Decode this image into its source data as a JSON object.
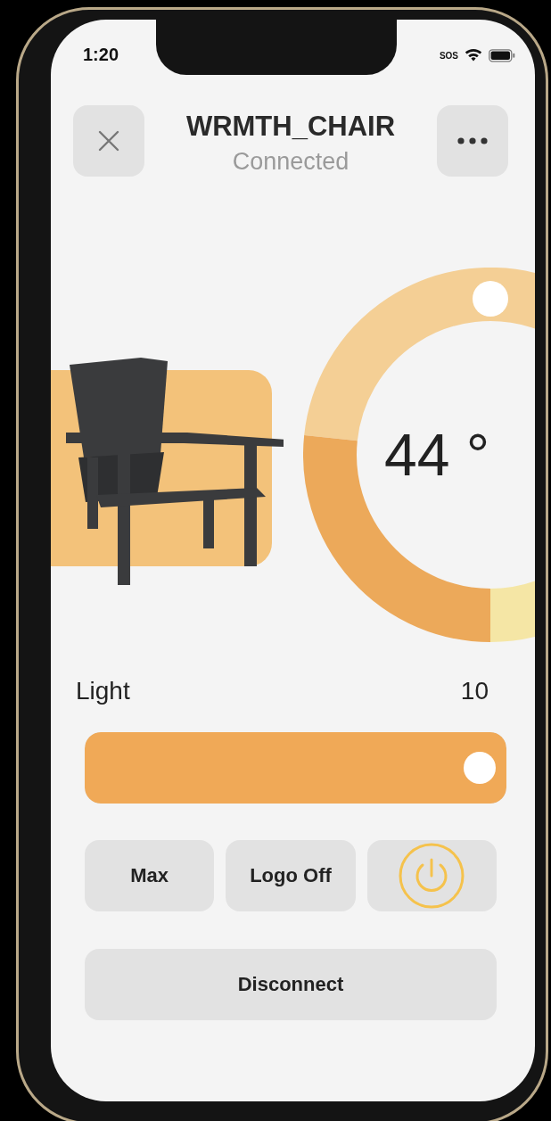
{
  "status_bar": {
    "time": "1:20",
    "sos": "SOS"
  },
  "header": {
    "title": "WRMTH_CHAIR",
    "subtitle": "Connected"
  },
  "temperature": {
    "reading": "44 °"
  },
  "light": {
    "label": "Light",
    "value": "10",
    "level": 1.0
  },
  "buttons": [
    {
      "kind": "text",
      "label": "Max"
    },
    {
      "kind": "text",
      "label": "Logo Off"
    },
    {
      "kind": "power"
    }
  ],
  "disconnect": {
    "label": "Disconnect"
  }
}
